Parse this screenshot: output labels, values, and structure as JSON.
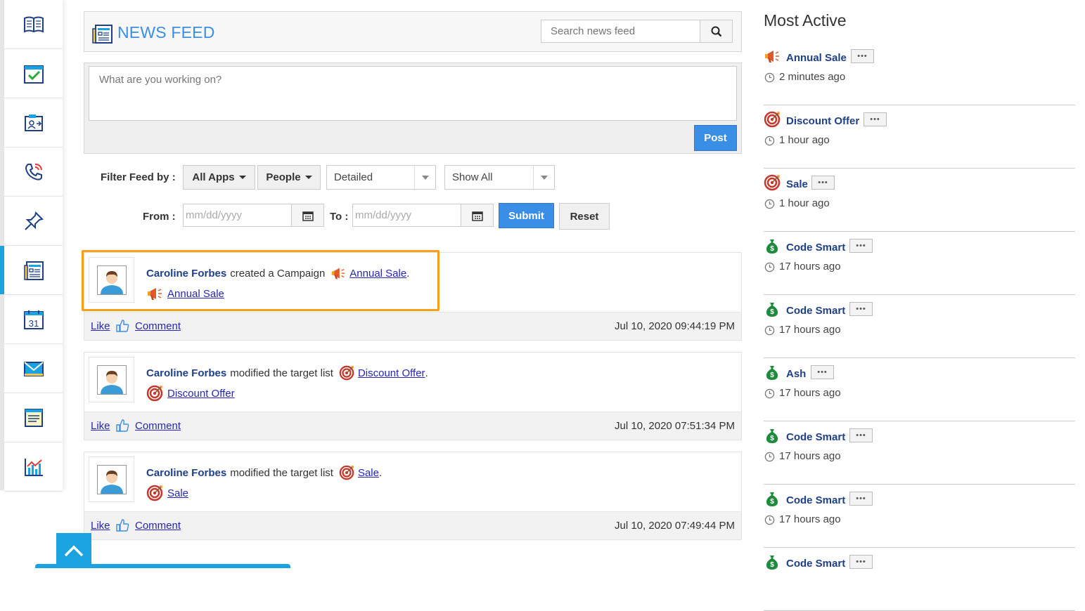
{
  "sidebar": {
    "items": [
      {
        "icon": "book-icon"
      },
      {
        "icon": "calendar-check-icon"
      },
      {
        "icon": "contact-card-icon"
      },
      {
        "icon": "phone-icon"
      },
      {
        "icon": "pin-icon"
      },
      {
        "icon": "news-feed-icon",
        "active": true
      },
      {
        "icon": "calendar-31-icon",
        "day": "31"
      },
      {
        "icon": "email-icon"
      },
      {
        "icon": "notes-icon"
      },
      {
        "icon": "chart-icon"
      }
    ]
  },
  "header": {
    "title": "NEWS FEED",
    "search_placeholder": "Search news feed"
  },
  "composer": {
    "placeholder": "What are you working on?",
    "post_label": "Post"
  },
  "filters": {
    "label": "Filter Feed by :",
    "apps_label": "All Apps",
    "people_label": "People",
    "view_value": "Detailed",
    "show_value": "Show All",
    "from_label": "From :",
    "to_label": "To :",
    "date_placeholder": "mm/dd/yyyy",
    "submit_label": "Submit",
    "reset_label": "Reset"
  },
  "feed": {
    "like_label": "Like",
    "comment_label": "Comment",
    "posts": [
      {
        "actor": "Caroline Forbes",
        "action": "created a Campaign",
        "icon": "megaphone-icon",
        "link": "Annual Sale",
        "suffix": ".",
        "time": "Jul 10, 2020 09:44:19 PM"
      },
      {
        "actor": "Caroline Forbes",
        "action": "modified the target list",
        "icon": "target-icon",
        "link": "Discount Offer",
        "suffix": ".",
        "time": "Jul 10, 2020 07:51:34 PM"
      },
      {
        "actor": "Caroline Forbes",
        "action": "modified the target list",
        "icon": "target-icon",
        "link": "Sale",
        "suffix": ".",
        "time": "Jul 10, 2020 07:49:44 PM"
      }
    ]
  },
  "most_active": {
    "title": "Most Active",
    "dots": "•••",
    "items": [
      {
        "name": "Annual Sale",
        "icon": "megaphone-icon",
        "time": "2 minutes ago"
      },
      {
        "name": "Discount Offer",
        "icon": "target-icon",
        "time": "1 hour ago"
      },
      {
        "name": "Sale",
        "icon": "target-icon",
        "time": "1 hour ago"
      },
      {
        "name": "Code Smart",
        "icon": "money-bag-icon",
        "time": "17 hours ago"
      },
      {
        "name": "Code Smart",
        "icon": "money-bag-icon",
        "time": "17 hours ago"
      },
      {
        "name": "Ash",
        "icon": "money-bag-icon",
        "time": "17 hours ago"
      },
      {
        "name": "Code Smart",
        "icon": "money-bag-icon",
        "time": "17 hours ago"
      },
      {
        "name": "Code Smart",
        "icon": "money-bag-icon",
        "time": "17 hours ago"
      },
      {
        "name": "Code Smart",
        "icon": "money-bag-icon",
        "time": ""
      }
    ]
  },
  "colors": {
    "accent": "#3a8ee6",
    "sidebar_active": "#1aa3e0",
    "highlight": "#f5a01c",
    "link": "#2626b8",
    "name": "#1f3f87"
  }
}
